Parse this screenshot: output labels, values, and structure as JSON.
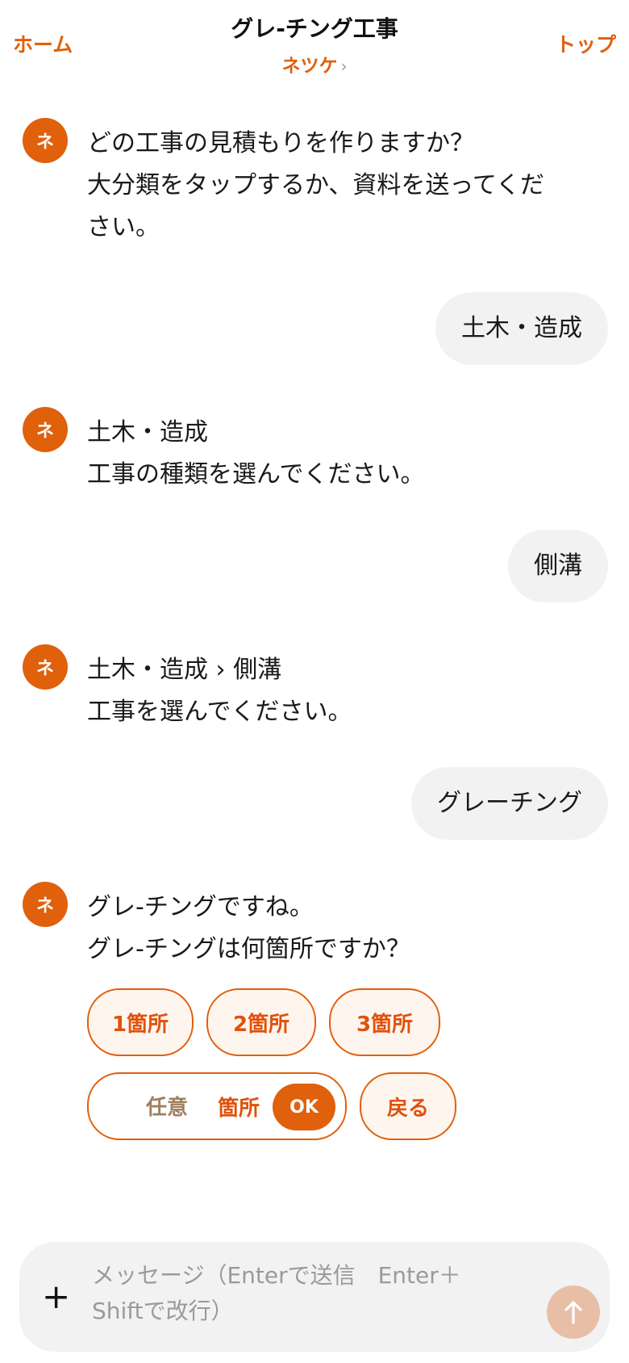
{
  "header": {
    "home_label": "ホーム",
    "top_label": "トップ",
    "title": "グレ-チング工事",
    "subtitle": "ネツケ",
    "subtitle_chevron": "›"
  },
  "avatar_label": "ネ",
  "messages": [
    {
      "role": "bot",
      "lines": [
        "どの工事の見積もりを作りますか？",
        "大分類をタップするか、資料を送ってくだ",
        "さい。"
      ]
    },
    {
      "role": "user",
      "text": "土木・造成"
    },
    {
      "role": "bot",
      "lines": [
        "土木・造成",
        "工事の種類を選んでください。"
      ]
    },
    {
      "role": "user",
      "text": "側溝"
    },
    {
      "role": "bot",
      "lines": [
        "土木・造成 › 側溝",
        "工事を選んでください。"
      ]
    },
    {
      "role": "user",
      "text": "グレーチング"
    },
    {
      "role": "bot",
      "lines": [
        "グレ-チングですね。",
        "グレ-チングは何箇所ですか？"
      ]
    }
  ],
  "options": {
    "choices": [
      "1箇所",
      "2箇所",
      "3箇所"
    ],
    "custom_placeholder": "任意",
    "custom_unit": "箇所",
    "ok_label": "OK",
    "back_label": "戻る"
  },
  "composer": {
    "plus_icon": "plus-icon",
    "placeholder": "メッセージ（Enterで送信　Enter＋Shiftで改行）",
    "send_icon": "arrow-up-icon"
  },
  "colors": {
    "accent": "#e0600c",
    "bubble_bg": "#f2f2f2",
    "send_disabled": "#e8bfa6",
    "option_bg": "#fff5ef"
  }
}
